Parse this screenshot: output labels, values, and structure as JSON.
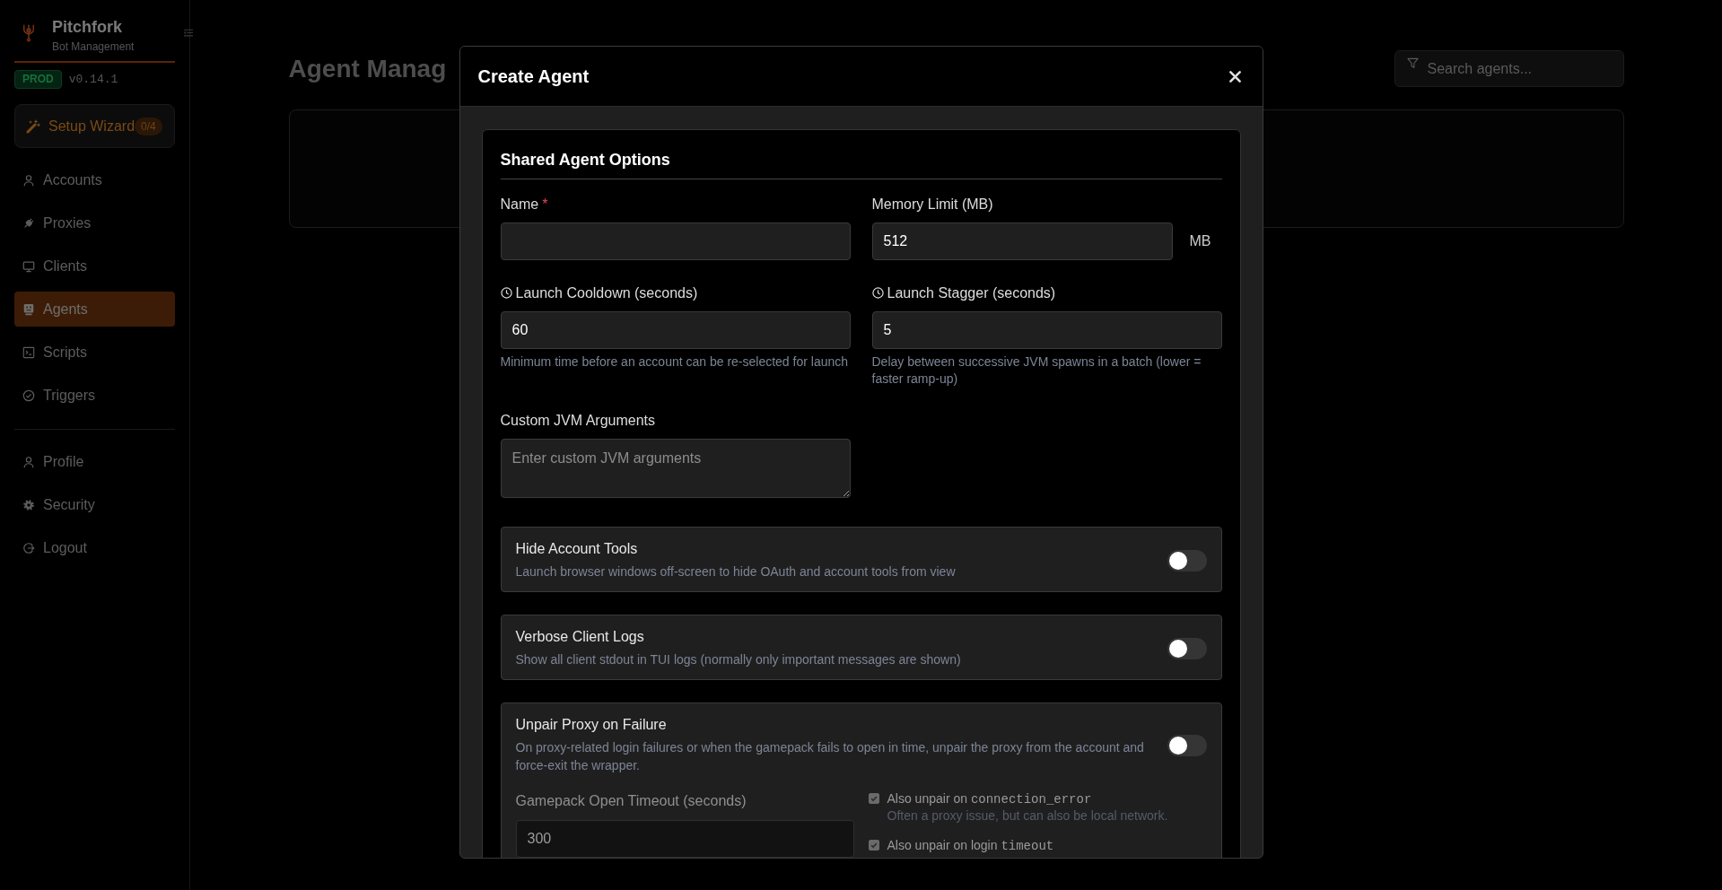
{
  "sidebar": {
    "brand": {
      "name": "Pitchfork",
      "subtitle": "Bot Management"
    },
    "environment": "PROD",
    "version": "v0.14.1",
    "setup_wizard": {
      "label": "Setup Wizard",
      "progress": "0/4"
    },
    "nav": [
      {
        "label": "Accounts",
        "selected": false
      },
      {
        "label": "Proxies",
        "selected": false
      },
      {
        "label": "Clients",
        "selected": false
      },
      {
        "label": "Agents",
        "selected": true
      },
      {
        "label": "Scripts",
        "selected": false
      },
      {
        "label": "Triggers",
        "selected": false
      }
    ],
    "account_nav": [
      {
        "label": "Profile",
        "selected": false
      },
      {
        "label": "Security",
        "selected": false
      },
      {
        "label": "Logout",
        "selected": false
      }
    ]
  },
  "page": {
    "title": "Agent Manag",
    "search": {
      "placeholder": "Search agents..."
    }
  },
  "modal": {
    "title": "Create Agent",
    "section": {
      "title": "Shared Agent Options",
      "name": {
        "label": "Name",
        "required_mark": "*"
      },
      "memory_limit": {
        "label": "Memory Limit (MB)",
        "value": "512",
        "unit": "MB"
      },
      "launch_cooldown": {
        "label": "Launch Cooldown (seconds)",
        "value": "60",
        "help": "Minimum time before an account can be re-selected for launch"
      },
      "launch_stagger": {
        "label": "Launch Stagger (seconds)",
        "value": "5",
        "help": "Delay between successive JVM spawns in a batch (lower = faster ramp-up)"
      },
      "custom_jvm_arguments": {
        "label": "Custom JVM Arguments",
        "placeholder": "Enter custom JVM arguments"
      }
    },
    "toggles": [
      {
        "title": "Hide Account Tools",
        "description": "Launch browser windows off-screen to hide OAuth and account tools from view",
        "on": false
      },
      {
        "title": "Verbose Client Logs",
        "description": "Show all client stdout in TUI logs (normally only important messages are shown)",
        "on": false
      },
      {
        "title": "Unpair Proxy on Failure",
        "description": "On proxy-related login failures or when the gamepack fails to open in time, unpair the proxy from the account and force-exit the wrapper.",
        "on": false
      }
    ],
    "unpair_options": {
      "timeout": {
        "label": "Gamepack Open Timeout (seconds)",
        "value": "300",
        "disabled": true
      },
      "checks": [
        {
          "label": "Also unpair on",
          "code": "connection_error",
          "help": "Often a proxy issue, but can also be local network.",
          "checked": true,
          "disabled": true
        },
        {
          "label": "Also unpair on login",
          "code": "timeout",
          "checked": true,
          "disabled": true
        }
      ]
    }
  }
}
